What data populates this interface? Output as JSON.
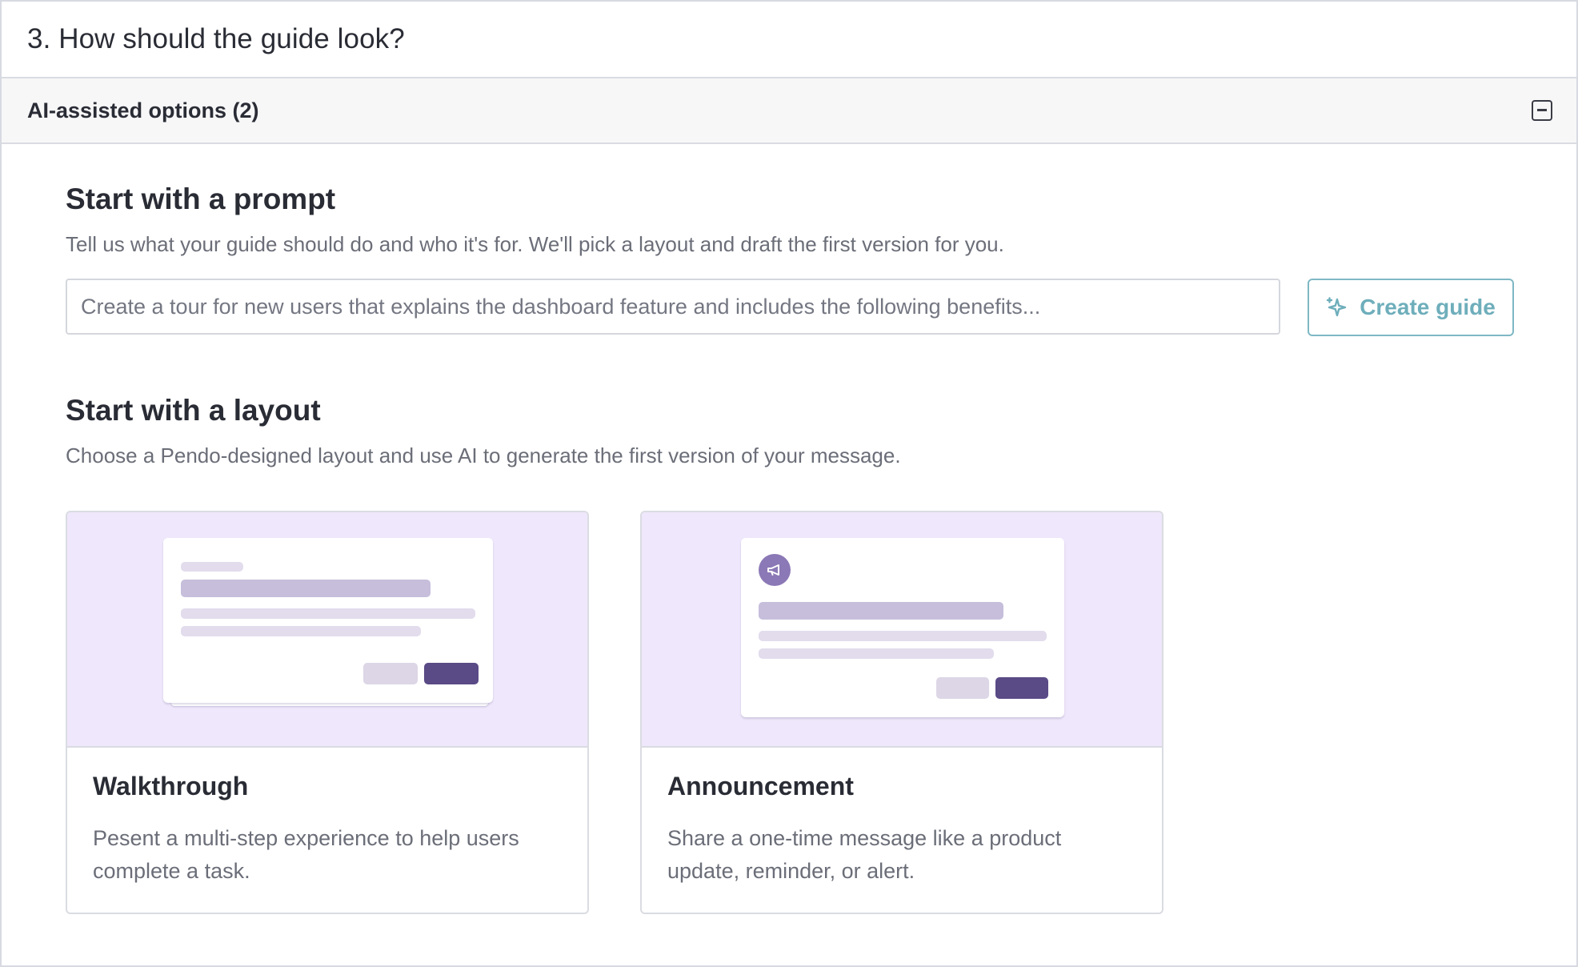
{
  "step": {
    "title": "3. How should the guide look?"
  },
  "section": {
    "title": "AI-assisted options (2)",
    "toggle_icon": "collapse-icon"
  },
  "prompt": {
    "title": "Start with a prompt",
    "description": "Tell us what your guide should do and who it's for. We'll pick a layout and draft the first version for you.",
    "input_value": "",
    "input_placeholder": "Create a tour for new users that explains the dashboard feature and includes the following benefits...",
    "button_label": "Create guide",
    "button_icon": "sparkle-icon",
    "accent_color": "#6eaebb"
  },
  "layout": {
    "title": "Start with a layout",
    "description": "Choose a Pendo-designed layout and use AI to generate the first version of your message.",
    "cards": [
      {
        "name": "Walkthrough",
        "description": "Pesent a multi-step experience to help users complete a task."
      },
      {
        "name": "Announcement",
        "description": "Share a one-time message like a product update, reminder, or alert.",
        "icon": "megaphone-icon"
      }
    ],
    "preview_bg_color": "#efe7fb",
    "primary_color": "#5a4a86"
  }
}
